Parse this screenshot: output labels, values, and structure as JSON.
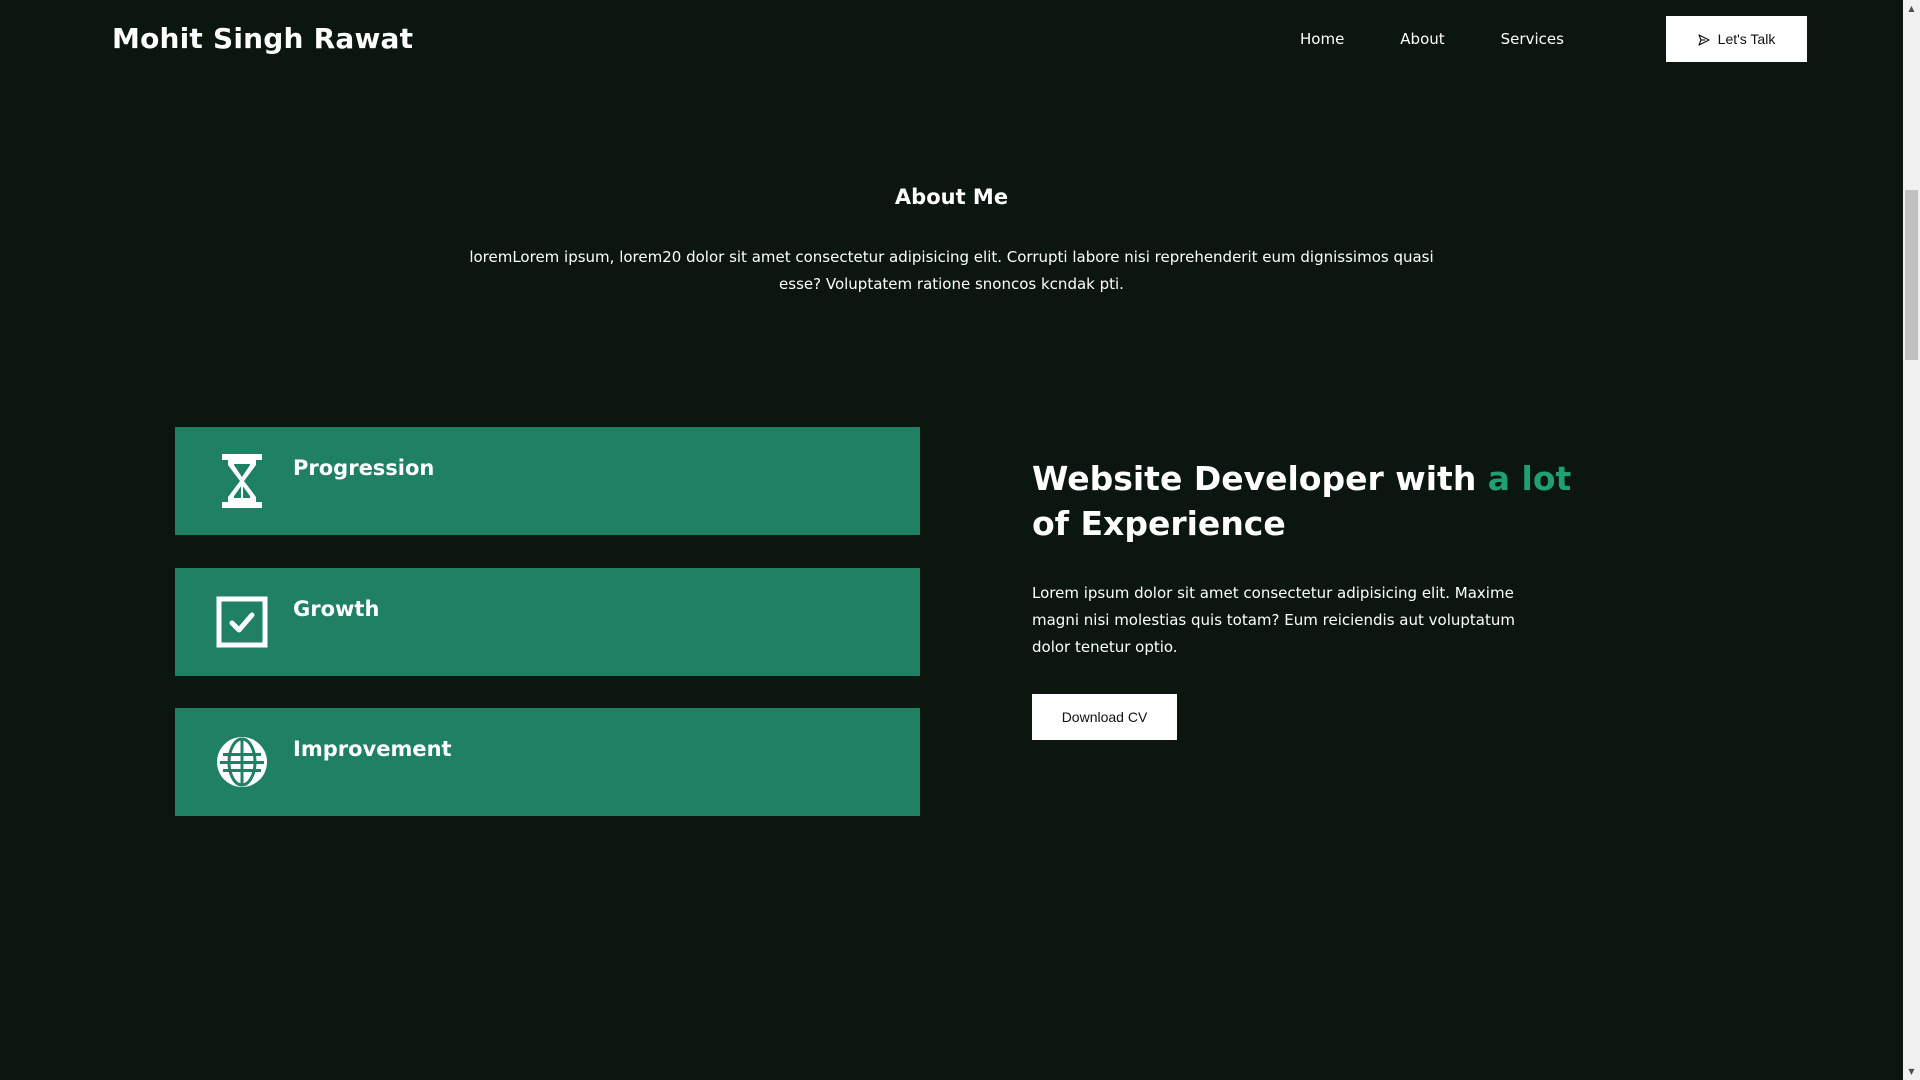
{
  "header": {
    "brand": "Mohit Singh Rawat",
    "nav": [
      "Home",
      "About",
      "Services"
    ],
    "cta_label": "Let's Talk"
  },
  "about": {
    "title": "About Me",
    "text": "loremLorem ipsum, lorem20 dolor sit amet consectetur adipisicing elit. Corrupti labore nisi reprehenderit eum dignissimos quasi esse? Voluptatem ratione snoncos kcndak pti."
  },
  "cards": [
    {
      "title": "Progression",
      "icon": "hourglass-icon"
    },
    {
      "title": "Growth",
      "icon": "checkbox-icon"
    },
    {
      "title": "Improvement",
      "icon": "globe-icon"
    }
  ],
  "hero": {
    "heading_before": "Website Developer with ",
    "heading_accent": "a lot",
    "heading_after": " of Experience",
    "text": "Lorem ipsum dolor sit amet consectetur adipisicing elit. Maxime magni nisi molestias quis totam? Eum reiciendis aut voluptatum dolor tenetur optio.",
    "button_label": "Download CV"
  },
  "colors": {
    "background": "#0a160e",
    "card": "#1f8063",
    "accent": "#1fa070",
    "button": "#ffffff"
  }
}
